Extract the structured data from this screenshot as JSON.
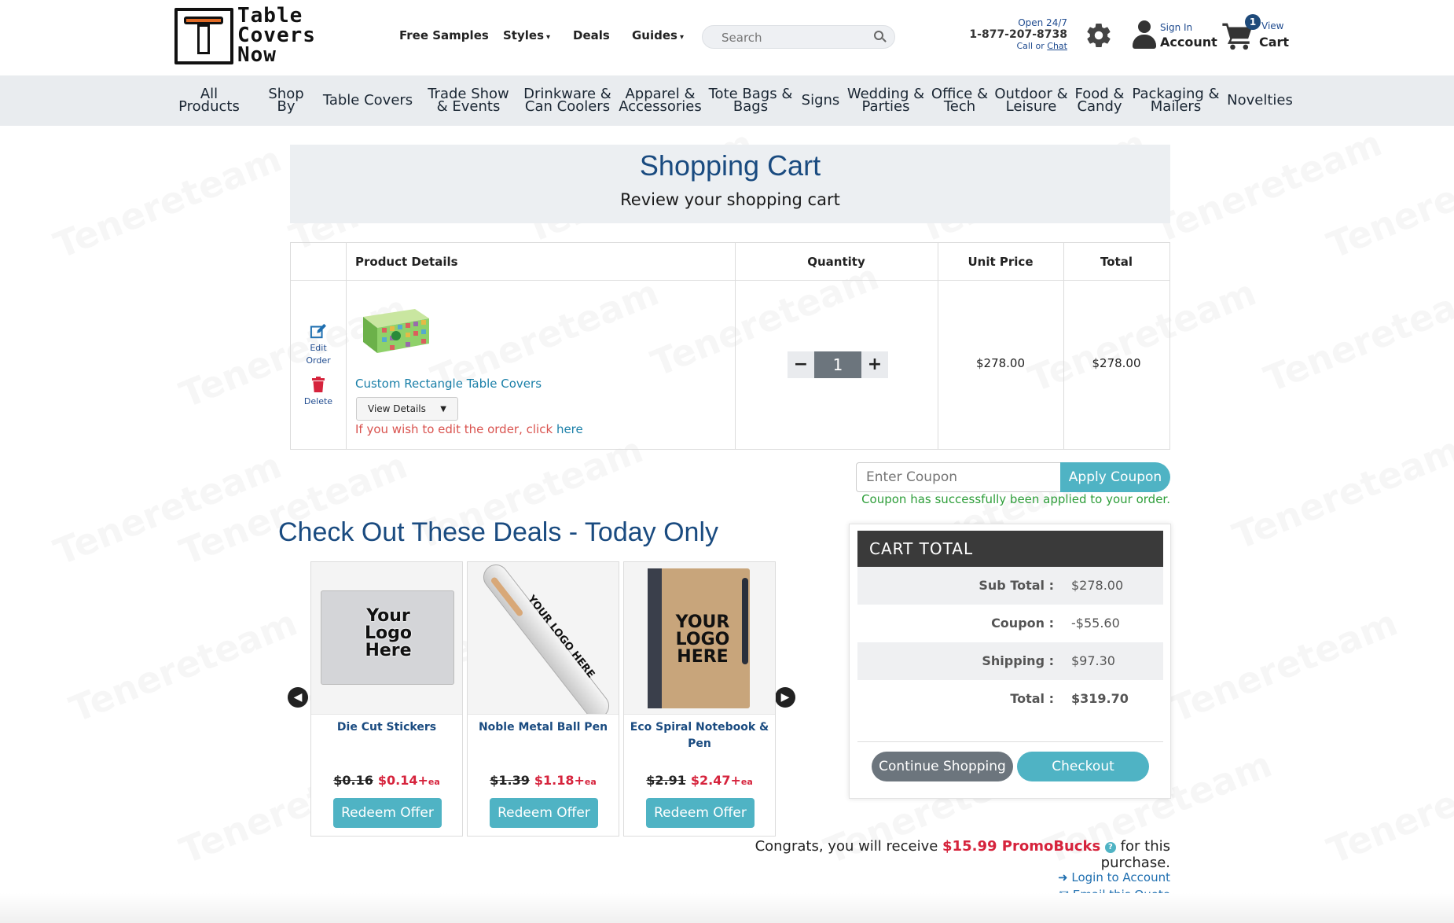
{
  "header": {
    "logo_lines": [
      "Table",
      "Covers",
      "Now"
    ],
    "nav": [
      {
        "label": "Free Samples",
        "caret": false
      },
      {
        "label": "Styles",
        "caret": true
      },
      {
        "label": "Deals",
        "caret": false
      },
      {
        "label": "Guides",
        "caret": true
      }
    ],
    "search_placeholder": "Search",
    "phone": {
      "open": "Open 24/7",
      "number": "1-877-207-8738",
      "call": "Call or ",
      "chat": "Chat"
    },
    "account": {
      "sign_in": "Sign In",
      "label": "Account"
    },
    "cart": {
      "count": "1",
      "view": "View",
      "label": "Cart"
    }
  },
  "categories": [
    "All Products",
    "Shop By",
    "Table Covers",
    "Trade Show & Events",
    "Drinkware & Can Coolers",
    "Apparel & Accessories",
    "Tote Bags & Bags",
    "Signs",
    "Wedding & Parties",
    "Office & Tech",
    "Outdoor & Leisure",
    "Food & Candy",
    "Packaging & Mailers",
    "Novelties"
  ],
  "cart_header": {
    "title": "Shopping Cart",
    "subtitle": "Review your shopping cart"
  },
  "table": {
    "columns": [
      "Product Details",
      "Quantity",
      "Unit Price",
      "Total"
    ],
    "edit_label": "Edit Order",
    "delete_label": "Delete",
    "item": {
      "name": "Custom Rectangle Table Covers",
      "view_details": "View Details",
      "edit_note": "If you wish to edit the order, click ",
      "edit_link": "here",
      "quantity": "1",
      "unit_price": "$278.00",
      "total": "$278.00"
    }
  },
  "coupon": {
    "placeholder": "Enter Coupon",
    "apply": "Apply Coupon",
    "message": "Coupon has successfully been applied to your order."
  },
  "deals": {
    "title": "Check Out These Deals - Today Only",
    "items": [
      {
        "name": "Die Cut Stickers",
        "old_price": "$0.16",
        "new_price": "$0.14+",
        "unit": "ea",
        "button": "Redeem Offer",
        "img_text": "Your Logo Here"
      },
      {
        "name": "Noble Metal Ball Pen",
        "old_price": "$1.39",
        "new_price": "$1.18+",
        "unit": "ea",
        "button": "Redeem Offer",
        "img_text": "YOUR LOGO HERE"
      },
      {
        "name": "Eco Spiral Notebook & Pen",
        "old_price": "$2.91",
        "new_price": "$2.47+",
        "unit": "ea",
        "button": "Redeem Offer",
        "img_text": "YOUR LOGO HERE"
      }
    ]
  },
  "totals": {
    "header": "CART  TOTAL",
    "rows": [
      {
        "label": "Sub Total :",
        "value": "$278.00"
      },
      {
        "label": "Coupon :",
        "value": "-$55.60"
      },
      {
        "label": "Shipping :",
        "value": "$97.30"
      },
      {
        "label": "Total :",
        "value": "$319.70"
      }
    ],
    "continue": "Continue Shopping",
    "checkout": "Checkout"
  },
  "promo": {
    "prefix": "Congrats, you will receive ",
    "amount": "$15.99 PromoBucks",
    "suffix": " for this purchase."
  },
  "links": {
    "login": "Login to Account",
    "email": "Email this Quote"
  },
  "watermark": "Tenereteam",
  "colors": {
    "brand_blue": "#1a4b80",
    "accent_teal": "#4fb3c4",
    "sale_red": "#d6233c",
    "success_green": "#2e9e3a"
  }
}
